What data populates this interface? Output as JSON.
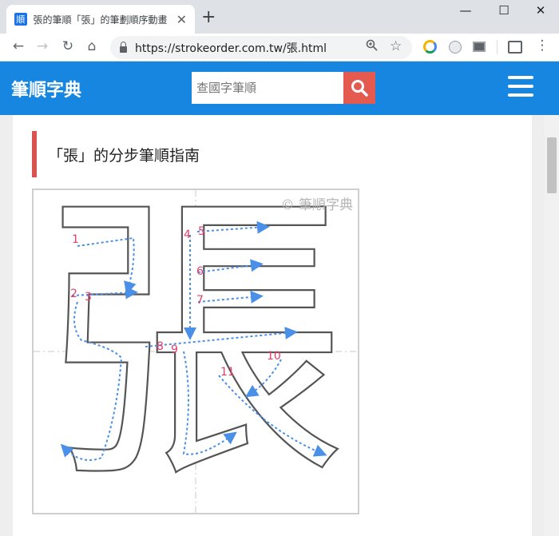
{
  "browser": {
    "tab_title": "張的筆順「張」的筆劃順序動畫",
    "tab_favicon": "順",
    "url": "https://strokeorder.com.tw/張.html"
  },
  "site": {
    "brand": "筆順字典",
    "search_placeholder": "查國字筆順"
  },
  "main": {
    "heading": "「張」的分步筆順指南",
    "watermark": "© 筆順字典",
    "character": "張",
    "stroke_numbers": [
      "1",
      "2",
      "3",
      "4",
      "5",
      "6",
      "7",
      "8",
      "9",
      "10",
      "11"
    ]
  },
  "colors": {
    "header": "#1686e0",
    "search_button": "#e45a4f",
    "accent_bar": "#d9534f",
    "stroke_number": "#e0406a",
    "guide_arrow": "#4a8fe8"
  }
}
